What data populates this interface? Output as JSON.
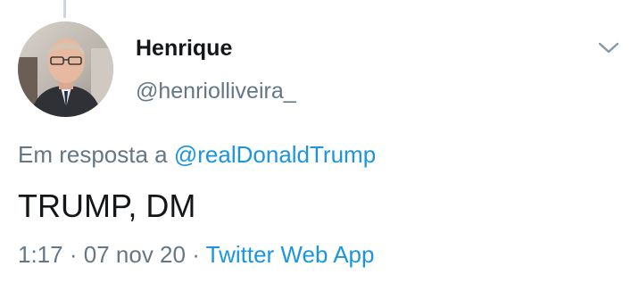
{
  "tweet": {
    "display_name": "Henrique",
    "handle": "@henriolliveira_",
    "reply_prefix": "Em resposta a",
    "reply_to": "@realDonaldTrump",
    "text": "TRUMP, DM",
    "time": "1:17",
    "separator": "·",
    "date": "07 nov 20",
    "source": "Twitter Web App"
  },
  "colors": {
    "link": "#1b95e0",
    "secondary_text": "#657786",
    "primary_text": "#14171a"
  },
  "icons": {
    "menu": "chevron-down-icon",
    "avatar": "avatar"
  }
}
